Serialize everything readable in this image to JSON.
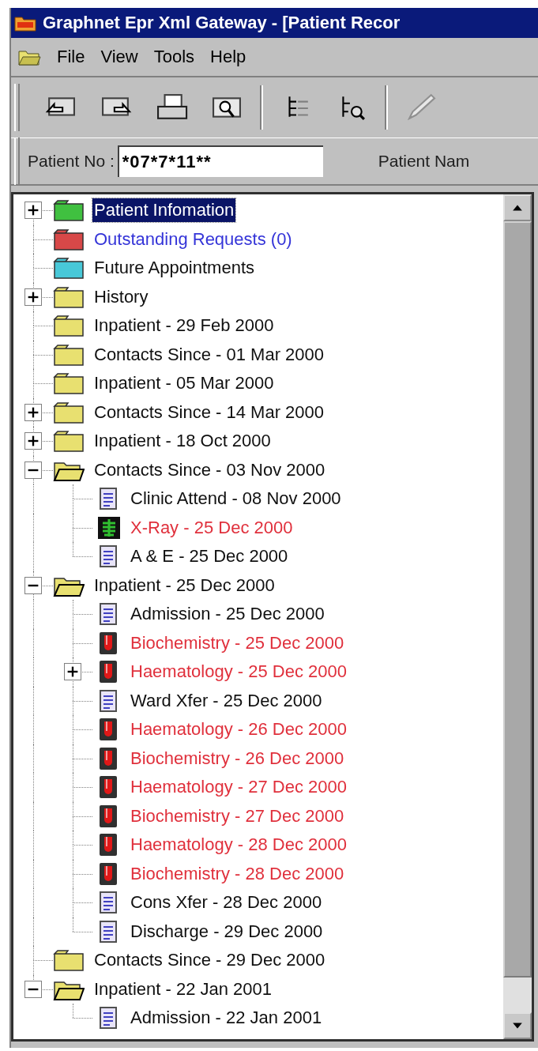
{
  "window": {
    "title": "Graphnet Epr Xml Gateway - [Patient Recor"
  },
  "menu": [
    "File",
    "View",
    "Tools",
    "Help"
  ],
  "patient_bar": {
    "number_label": "Patient No :",
    "number_value": "*07*7*11**",
    "name_label": "Patient Nam"
  },
  "tree": [
    {
      "label": "Patient Infomation",
      "kind": "folder",
      "color": "#40c040",
      "link": false,
      "flagged": false,
      "selected": true,
      "expanded": false
    },
    {
      "label": "Outstanding Requests (0)",
      "kind": "folder",
      "color": "#d84848",
      "link": true,
      "flagged": false,
      "selected": false
    },
    {
      "label": "Future Appointments",
      "kind": "folder",
      "color": "#48c8d8",
      "link": false,
      "flagged": false,
      "selected": false
    },
    {
      "label": "History",
      "kind": "folder",
      "color": "#e8e070",
      "link": false,
      "flagged": false,
      "selected": false,
      "expanded": false
    },
    {
      "label": "Inpatient - 29 Feb 2000",
      "kind": "folder",
      "color": "#e8e070",
      "link": false,
      "flagged": false,
      "selected": false
    },
    {
      "label": "Contacts Since - 01 Mar 2000",
      "kind": "folder",
      "color": "#e8e070",
      "link": false,
      "flagged": false,
      "selected": false
    },
    {
      "label": "Inpatient - 05 Mar 2000",
      "kind": "folder",
      "color": "#e8e070",
      "link": false,
      "flagged": false,
      "selected": false
    },
    {
      "label": "Contacts Since - 14 Mar 2000",
      "kind": "folder",
      "color": "#e8e070",
      "link": false,
      "flagged": false,
      "selected": false,
      "expanded": false
    },
    {
      "label": "Inpatient - 18 Oct 2000",
      "kind": "folder",
      "color": "#e8e070",
      "link": false,
      "flagged": false,
      "selected": false,
      "expanded": false
    },
    {
      "label": "Contacts Since - 03 Nov 2000",
      "kind": "folder",
      "color": "#e8e070",
      "link": false,
      "flagged": false,
      "selected": false,
      "expanded": true,
      "children": [
        {
          "label": "Clinic Attend - 08 Nov 2000",
          "kind": "document",
          "link": false,
          "flagged": false,
          "selected": false
        },
        {
          "label": "X-Ray - 25 Dec 2000",
          "kind": "xray",
          "link": false,
          "flagged": true,
          "selected": false
        },
        {
          "label": "A & E - 25 Dec 2000",
          "kind": "document",
          "link": false,
          "flagged": false,
          "selected": false
        }
      ]
    },
    {
      "label": "Inpatient - 25 Dec 2000",
      "kind": "folder",
      "color": "#e8e070",
      "link": false,
      "flagged": false,
      "selected": false,
      "expanded": true,
      "children": [
        {
          "label": "Admission - 25 Dec 2000",
          "kind": "document",
          "link": false,
          "flagged": false,
          "selected": false
        },
        {
          "label": "Biochemistry - 25 Dec 2000",
          "kind": "lab",
          "link": false,
          "flagged": true,
          "selected": false
        },
        {
          "label": "Haematology - 25 Dec 2000",
          "kind": "lab",
          "link": false,
          "flagged": true,
          "selected": false,
          "expanded": false
        },
        {
          "label": "Ward Xfer - 25 Dec 2000",
          "kind": "document",
          "link": false,
          "flagged": false,
          "selected": false
        },
        {
          "label": "Haematology - 26 Dec 2000",
          "kind": "lab",
          "link": false,
          "flagged": true,
          "selected": false
        },
        {
          "label": "Biochemistry - 26 Dec 2000",
          "kind": "lab",
          "link": false,
          "flagged": true,
          "selected": false
        },
        {
          "label": "Haematology - 27 Dec 2000",
          "kind": "lab",
          "link": false,
          "flagged": true,
          "selected": false
        },
        {
          "label": "Biochemistry - 27 Dec 2000",
          "kind": "lab",
          "link": false,
          "flagged": true,
          "selected": false
        },
        {
          "label": "Haematology - 28 Dec 2000",
          "kind": "lab",
          "link": false,
          "flagged": true,
          "selected": false
        },
        {
          "label": "Biochemistry - 28 Dec 2000",
          "kind": "lab",
          "link": false,
          "flagged": true,
          "selected": false
        },
        {
          "label": "Cons Xfer - 28 Dec 2000",
          "kind": "document",
          "link": false,
          "flagged": false,
          "selected": false
        },
        {
          "label": "Discharge - 29 Dec 2000",
          "kind": "document",
          "link": false,
          "flagged": false,
          "selected": false
        }
      ]
    },
    {
      "label": "Contacts Since - 29 Dec 2000",
      "kind": "folder",
      "color": "#e8e070",
      "link": false,
      "flagged": false,
      "selected": false
    },
    {
      "label": "Inpatient - 22 Jan 2001",
      "kind": "folder",
      "color": "#e8e070",
      "link": false,
      "flagged": false,
      "selected": false,
      "expanded": true,
      "children": [
        {
          "label": "Admission - 22 Jan 2001",
          "kind": "document",
          "link": false,
          "flagged": false,
          "selected": false
        }
      ]
    }
  ]
}
